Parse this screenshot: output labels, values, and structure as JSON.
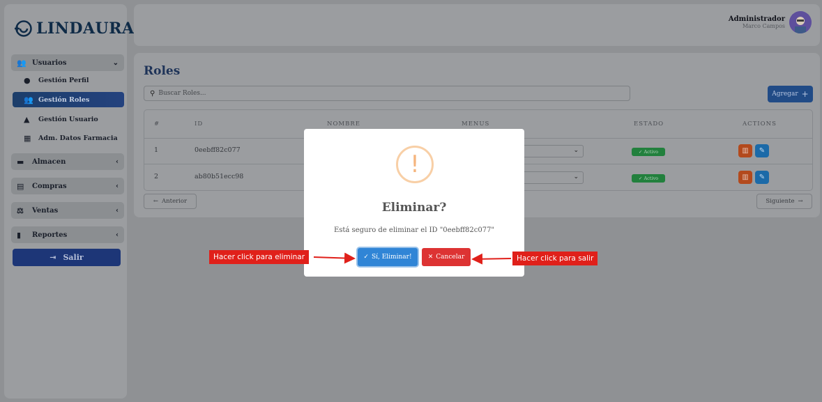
{
  "app": {
    "brand": "LINDAURA"
  },
  "sidebar": {
    "groups": [
      {
        "label": "Usuarios",
        "chevron": "⌄"
      },
      {
        "label": "Almacen",
        "chevron": "‹"
      },
      {
        "label": "Compras",
        "chevron": "‹"
      },
      {
        "label": "Ventas",
        "chevron": "‹"
      },
      {
        "label": "Reportes",
        "chevron": "‹"
      }
    ],
    "subitems": [
      {
        "label": "Gestión Perfil"
      },
      {
        "label": "Gestión Roles",
        "active": true
      },
      {
        "label": "Gestión Usuario"
      },
      {
        "label": "Adm. Datos Farmacia"
      }
    ],
    "logout": "Salir"
  },
  "header": {
    "user_role": "Administrador",
    "user_name": "Marco Campos"
  },
  "page": {
    "title": "Roles",
    "search_placeholder": "Buscar Roles...",
    "add_button": "Agregar",
    "table": {
      "columns": [
        "#",
        "ID",
        "NOMBRE",
        "MENUS",
        "ESTADO",
        "ACTIONS"
      ],
      "rows": [
        {
          "num": "1",
          "id": "0eebff82c077",
          "estado": "Activo"
        },
        {
          "num": "2",
          "id": "ab80b51ecc98",
          "estado": "Activo"
        }
      ]
    },
    "pagination": {
      "prev": "Anterior",
      "next": "Siguiente"
    }
  },
  "modal": {
    "icon": "!",
    "title": "Eliminar?",
    "text": "Está seguro de eliminar el ID \"0eebff82c077\"",
    "confirm_label": "Sí, Eliminar!",
    "cancel_label": "Cancelar"
  },
  "annotations": {
    "left_callout": "Hacer click para eliminar",
    "right_callout": "Hacer click para salir"
  },
  "colors": {
    "brand_navy": "#0f2b47",
    "active_item": "#1c3e6a",
    "confirm_blue": "#3085d6",
    "cancel_red": "#dd3333",
    "warning_orange": "#f8bb86",
    "callout_red": "#e0201a",
    "status_green": "#22803d"
  }
}
